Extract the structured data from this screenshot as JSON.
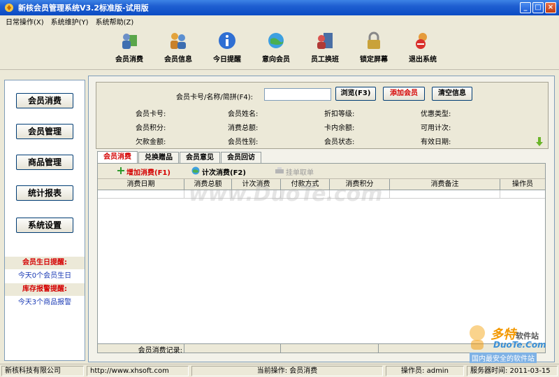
{
  "window": {
    "title": "新核会员管理系统V3.2标准版-试用版",
    "buttons": {
      "minimize": "_",
      "maximize": "□",
      "close": "×"
    }
  },
  "menu": [
    "日常操作(X)",
    "系统维护(Y)",
    "系统帮助(Z)"
  ],
  "toolbar": [
    {
      "label": "会员消费",
      "icon": "member-consume-icon"
    },
    {
      "label": "会员信息",
      "icon": "member-info-icon"
    },
    {
      "label": "今日提醒",
      "icon": "info-icon"
    },
    {
      "label": "意向会员",
      "icon": "globe-people-icon"
    },
    {
      "label": "员工换班",
      "icon": "employee-shift-icon"
    },
    {
      "label": "锁定屏幕",
      "icon": "lock-icon"
    },
    {
      "label": "退出系统",
      "icon": "exit-icon"
    }
  ],
  "sidebar": {
    "buttons": [
      "会员消费",
      "会员管理",
      "商品管理",
      "统计报表",
      "系统设置"
    ],
    "birthday_title": "会员生日提醒:",
    "birthday_text": "今天0个会员生日",
    "stock_title": "库存报警提醒:",
    "stock_text": "今天3个商品报警"
  },
  "search": {
    "label": "会员卡号/名称/简拼(F4):",
    "value": "",
    "browse": "浏览(F3)",
    "add_member": "添加会员",
    "clear": "清空信息"
  },
  "info": {
    "row1": [
      "会员卡号:",
      "会员姓名:",
      "折扣等级:",
      "优惠类型:"
    ],
    "row2": [
      "会员积分:",
      "消费总额:",
      "卡内余额:",
      "可用计次:"
    ],
    "row3": [
      "欠款金额:",
      "会员性别:",
      "会员状态:",
      "有效日期:"
    ]
  },
  "tabs": [
    "会员消费",
    "兑换赠品",
    "会员意见",
    "会员回访"
  ],
  "actions": {
    "add_consume": "增加消费(F1)",
    "count_consume": "计次消费(F2)",
    "hang_order": "挂单取单"
  },
  "table": {
    "columns": [
      "消费日期",
      "消费总额",
      "计次消费",
      "付款方式",
      "消费积分",
      "消费备注",
      "操作员"
    ]
  },
  "footer_record": "会员消费记录:",
  "statusbar": {
    "company": "新核科技有限公司",
    "url": "http://www.xhsoft.com",
    "operation": "当前操作: 会员消费",
    "operator": "操作员: admin",
    "server_time": "服务器时间: 2011-03-15"
  },
  "watermarks": {
    "center": "www.DuoTe.com",
    "brand": "多特",
    "brand_suffix": "软件站",
    "brand_domain": "DuoTe.Com",
    "brand_slogan": "国内最安全的软件站"
  },
  "colors": {
    "title_blue": "#0a4bc4",
    "accent_red": "#d40000",
    "link_blue": "#1a3ab5"
  }
}
